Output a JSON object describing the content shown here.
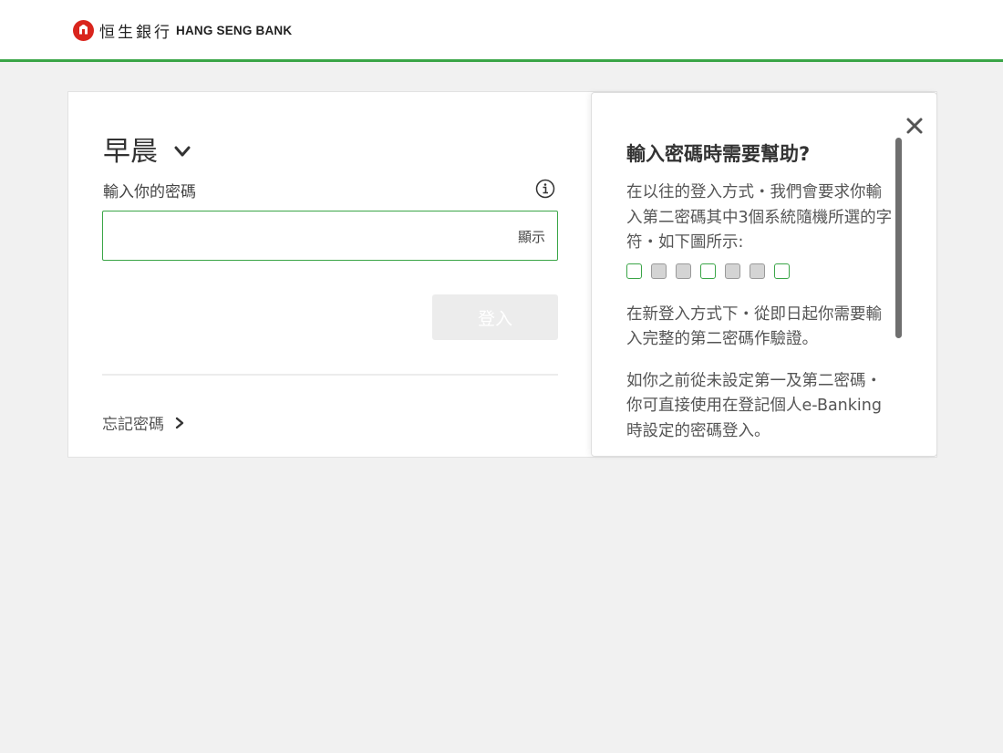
{
  "header": {
    "logo_cn": "恒生銀行",
    "logo_en": "HANG SENG BANK",
    "accent": "#3aa547",
    "brand_red": "#d9251d"
  },
  "login": {
    "greeting": "早晨",
    "greeting_icon": "chevron-down-icon",
    "password_label": "輸入你的密碼",
    "info_icon": "info-icon",
    "password_value": "",
    "show_label": "顯示",
    "login_button": "登入",
    "forgot_label": "忘記密碼",
    "forgot_icon": "chevron-right-icon"
  },
  "help": {
    "title": "輸入密碼時需要幫助?",
    "p1": "在以往的登入方式・我們會要求你輸入第二密碼其中3個系統隨機所選的字符・如下圖所示:",
    "boxes": [
      "open",
      "filled",
      "filled",
      "open",
      "filled",
      "filled",
      "open"
    ],
    "p2": "在新登入方式下・從即日起你需要輸入完整的第二密碼作驗證。",
    "p3": "如你之前從未設定第一及第二密碼・你可直接使用在登記個人e-Banking時設定的密碼登入。",
    "close_icon": "close-icon"
  }
}
